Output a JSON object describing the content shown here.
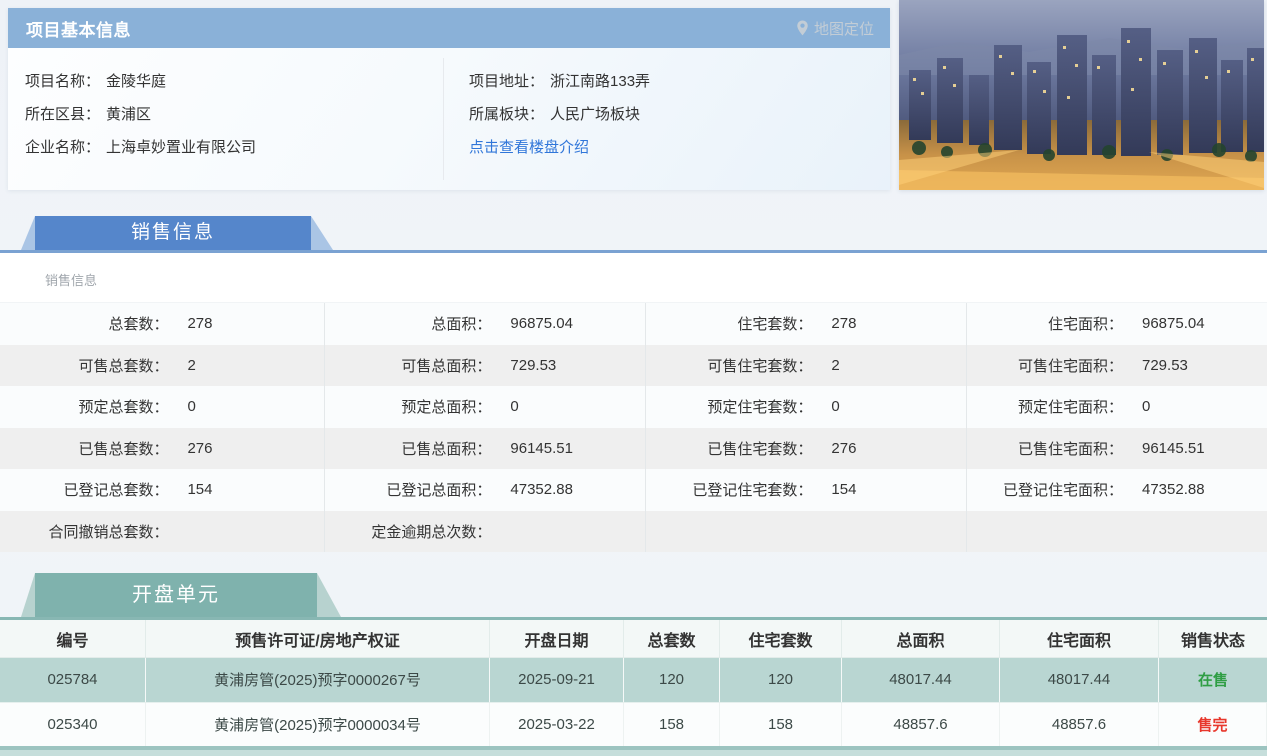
{
  "colors": {
    "header_blue": "#8ab1d8",
    "tab_blue": "#5586cb",
    "tab_teal": "#7fb2ad",
    "row_highlight_teal": "#b9d6d2",
    "link_blue": "#3076d9",
    "status_onsale_green": "#2f9e44",
    "status_soldout_red": "#e8372c"
  },
  "project_info": {
    "title": "项目基本信息",
    "map_link": "地图定位",
    "left_fields": [
      {
        "label": "项目名称：",
        "value": "金陵华庭"
      },
      {
        "label": "所在区县：",
        "value": "黄浦区"
      },
      {
        "label": "企业名称：",
        "value": "上海卓妙置业有限公司"
      }
    ],
    "right_fields": [
      {
        "label": "项目地址：",
        "value": "浙江南路133弄"
      },
      {
        "label": "所属板块：",
        "value": "人民广场板块"
      }
    ],
    "intro_link": "点击查看楼盘介绍"
  },
  "sales": {
    "tab_title": "销售信息",
    "subtitle": "销售信息",
    "rows": [
      [
        {
          "label": "总套数：",
          "value": "278"
        },
        {
          "label": "总面积：",
          "value": "96875.04"
        },
        {
          "label": "住宅套数：",
          "value": "278"
        },
        {
          "label": "住宅面积：",
          "value": "96875.04"
        }
      ],
      [
        {
          "label": "可售总套数：",
          "value": "2"
        },
        {
          "label": "可售总面积：",
          "value": "729.53"
        },
        {
          "label": "可售住宅套数：",
          "value": "2"
        },
        {
          "label": "可售住宅面积：",
          "value": "729.53"
        }
      ],
      [
        {
          "label": "预定总套数：",
          "value": "0"
        },
        {
          "label": "预定总面积：",
          "value": "0"
        },
        {
          "label": "预定住宅套数：",
          "value": "0"
        },
        {
          "label": "预定住宅面积：",
          "value": "0"
        }
      ],
      [
        {
          "label": "已售总套数：",
          "value": "276"
        },
        {
          "label": "已售总面积：",
          "value": "96145.51"
        },
        {
          "label": "已售住宅套数：",
          "value": "276"
        },
        {
          "label": "已售住宅面积：",
          "value": "96145.51"
        }
      ],
      [
        {
          "label": "已登记总套数：",
          "value": "154"
        },
        {
          "label": "已登记总面积：",
          "value": "47352.88"
        },
        {
          "label": "已登记住宅套数：",
          "value": "154"
        },
        {
          "label": "已登记住宅面积：",
          "value": "47352.88"
        }
      ],
      [
        {
          "label": "合同撤销总套数：",
          "value": ""
        },
        {
          "label": "定金逾期总次数：",
          "value": ""
        },
        {
          "label": "",
          "value": ""
        },
        {
          "label": "",
          "value": ""
        }
      ]
    ]
  },
  "units": {
    "tab_title": "开盘单元",
    "columns": [
      "编号",
      "预售许可证/房地产权证",
      "开盘日期",
      "总套数",
      "住宅套数",
      "总面积",
      "住宅面积",
      "销售状态"
    ],
    "rows": [
      {
        "cells": [
          "025784",
          "黄浦房管(2025)预字0000267号",
          "2025-09-21",
          "120",
          "120",
          "48017.44",
          "48017.44"
        ],
        "status": "在售",
        "status_color": "#2f9e44"
      },
      {
        "cells": [
          "025340",
          "黄浦房管(2025)预字0000034号",
          "2025-03-22",
          "158",
          "158",
          "48857.6",
          "48857.6"
        ],
        "status": "售完",
        "status_color": "#e8372c"
      }
    ]
  }
}
